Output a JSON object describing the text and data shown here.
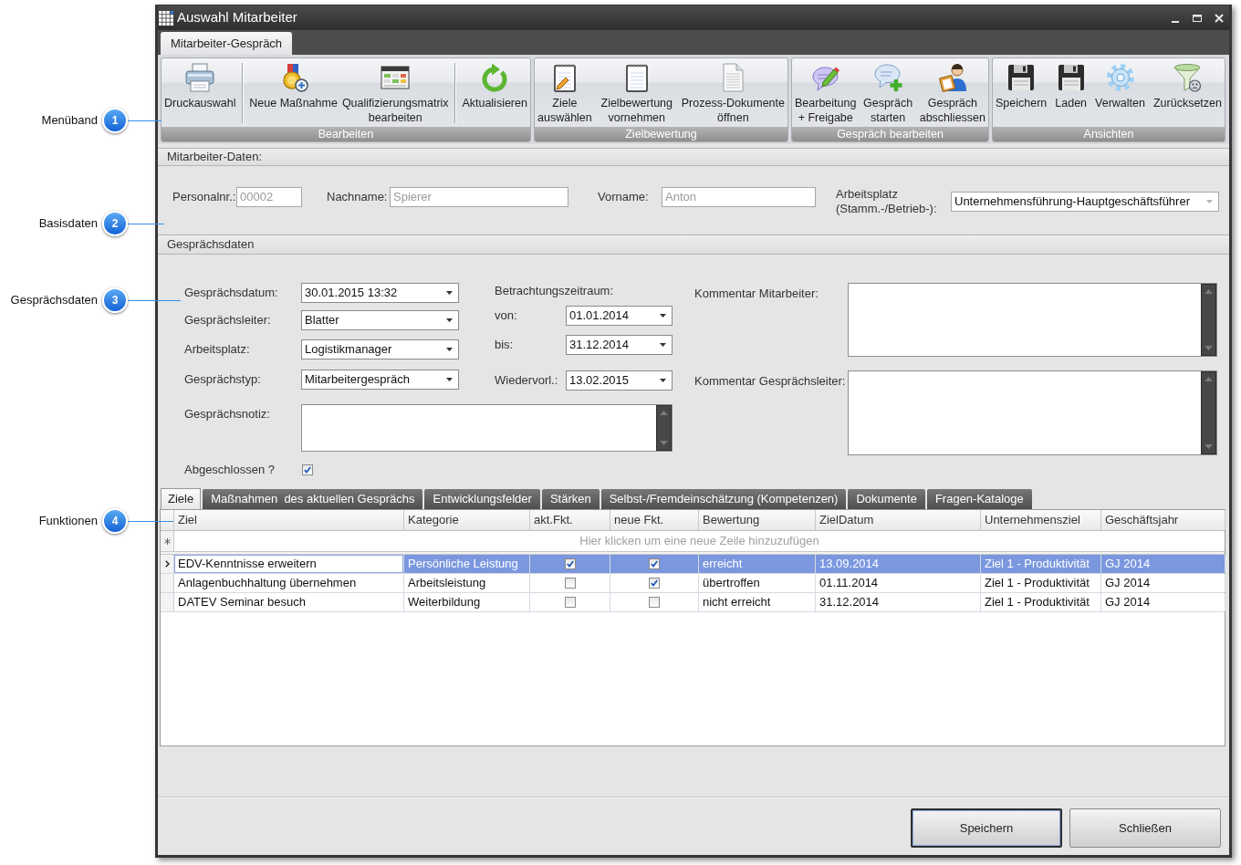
{
  "callouts": [
    {
      "number": "1",
      "label": "Menüband"
    },
    {
      "number": "2",
      "label": "Basisdaten"
    },
    {
      "number": "3",
      "label": "Gesprächsdaten"
    },
    {
      "number": "4",
      "label": "Funktionen"
    }
  ],
  "window": {
    "title": "Auswahl Mitarbeiter"
  },
  "ribbon": {
    "tabs": [
      {
        "label": "Mitarbeiter-Gespräch",
        "selected": true
      }
    ],
    "groups": [
      {
        "title": "Bearbeiten",
        "sections": [
          {
            "buttons": [
              {
                "label": "Druckauswahl"
              }
            ]
          },
          {
            "buttons": [
              {
                "label": "Neue Maßnahme"
              },
              {
                "label": "Qualifizierungsmatrix\nbearbeiten"
              }
            ]
          },
          {
            "buttons": [
              {
                "label": "Aktualisieren"
              }
            ]
          }
        ]
      },
      {
        "title": "Zielbewertung",
        "sections": [
          {
            "buttons": [
              {
                "label": "Ziele\nauswählen"
              },
              {
                "label": "Zielbewertung\nvornehmen"
              },
              {
                "label": "Prozess-Dokumente\nöffnen"
              }
            ]
          }
        ]
      },
      {
        "title": "Gespräch bearbeiten",
        "sections": [
          {
            "buttons": [
              {
                "label": "Bearbeitung\n+ Freigabe"
              },
              {
                "label": "Gespräch\nstarten"
              },
              {
                "label": "Gespräch\nabschliessen"
              }
            ]
          }
        ]
      },
      {
        "title": "Ansichten",
        "sections": [
          {
            "buttons": [
              {
                "label": "Speichern"
              },
              {
                "label": "Laden"
              },
              {
                "label": "Verwalten"
              },
              {
                "label": "Zurücksetzen"
              }
            ]
          }
        ]
      }
    ]
  },
  "mitarbeiter_daten": {
    "title": "Mitarbeiter-Daten:",
    "fields": [
      {
        "kind": "text",
        "label": "Personalnr.:",
        "value": "00002",
        "disabled": true
      },
      {
        "kind": "text",
        "label": "Nachname:",
        "value": "Spierer",
        "disabled": true
      },
      {
        "kind": "text",
        "label": "Vorname:",
        "value": "Anton",
        "disabled": true
      },
      {
        "kind": "dropdown",
        "label": "Arbeitsplatz\n(Stamm.-/Betrieb-):",
        "value": "Unternehmensführung-Hauptgeschäftsführer",
        "disabled": false
      }
    ]
  },
  "gespraechsdaten": {
    "title": "Gesprächsdaten",
    "left_fields": [
      {
        "label": "Gesprächsdatum:",
        "value": "30.01.2015 13:32"
      },
      {
        "label": "Gesprächsleiter:",
        "value": "Blatter"
      },
      {
        "label": "Arbeitsplatz:",
        "value": "Logistikmanager"
      },
      {
        "label": "Gesprächstyp:",
        "value": "Mitarbeitergespräch"
      }
    ],
    "period": {
      "label": "Betrachtungszeitraum:",
      "fields": [
        {
          "label": "von:",
          "value": "01.01.2014"
        },
        {
          "label": "bis:",
          "value": "31.12.2014"
        },
        {
          "label": "Wiedervorl.:",
          "value": "13.02.2015"
        }
      ]
    },
    "note": {
      "label": "Gesprächsnotiz:"
    },
    "closed": {
      "label": "Abgeschlossen ?",
      "checked": true
    },
    "comments": [
      {
        "label": "Kommentar Mitarbeiter:"
      },
      {
        "label": "Kommentar Gesprächsleiter:"
      }
    ]
  },
  "function_tabs": [
    {
      "label": "Ziele",
      "selected": true
    },
    {
      "label": "Maßnahmen  des aktuellen Gesprächs",
      "selected": false
    },
    {
      "label": "Entwicklungsfelder",
      "selected": false
    },
    {
      "label": "Stärken",
      "selected": false
    },
    {
      "label": "Selbst-/Fremdeinschätzung (Kompetenzen)",
      "selected": false
    },
    {
      "label": "Dokumente",
      "selected": false
    },
    {
      "label": "Fragen-Kataloge",
      "selected": false
    }
  ],
  "table": {
    "columns": [
      "Ziel",
      "Kategorie",
      "akt.Fkt.",
      "neue Fkt.",
      "Bewertung",
      "ZielDatum",
      "Unternehmensziel",
      "Geschäftsjahr"
    ],
    "new_row_hint": "Hier klicken um eine neue Zeile hinzuzufügen",
    "rows": [
      {
        "selected": true,
        "current": true,
        "cells": [
          {
            "kind": "text",
            "text": "EDV-Kenntnisse erweitern",
            "focused": true
          },
          {
            "kind": "text",
            "text": "Persönliche Leistung",
            "focused": false
          },
          {
            "kind": "checkbox",
            "checked": true,
            "focused": false
          },
          {
            "kind": "checkbox",
            "checked": true,
            "focused": false
          },
          {
            "kind": "text",
            "text": "erreicht",
            "focused": false
          },
          {
            "kind": "text",
            "text": "13.09.2014",
            "focused": false
          },
          {
            "kind": "text",
            "text": "Ziel 1 - Produktivität",
            "focused": false
          },
          {
            "kind": "text",
            "text": "GJ 2014",
            "focused": false
          }
        ]
      },
      {
        "selected": false,
        "current": false,
        "cells": [
          {
            "kind": "text",
            "text": "Anlagenbuchhaltung übernehmen",
            "focused": false
          },
          {
            "kind": "text",
            "text": "Arbeitsleistung",
            "focused": false
          },
          {
            "kind": "checkbox",
            "checked": false,
            "focused": false
          },
          {
            "kind": "checkbox",
            "checked": true,
            "focused": false
          },
          {
            "kind": "text",
            "text": "übertroffen",
            "focused": false
          },
          {
            "kind": "text",
            "text": "01.11.2014",
            "focused": false
          },
          {
            "kind": "text",
            "text": "Ziel 1 - Produktivität",
            "focused": false
          },
          {
            "kind": "text",
            "text": "GJ 2014",
            "focused": false
          }
        ]
      },
      {
        "selected": false,
        "current": false,
        "cells": [
          {
            "kind": "text",
            "text": "DATEV Seminar besuch",
            "focused": false
          },
          {
            "kind": "text",
            "text": "Weiterbildung",
            "focused": false
          },
          {
            "kind": "checkbox",
            "checked": false,
            "focused": false
          },
          {
            "kind": "checkbox",
            "checked": false,
            "focused": false
          },
          {
            "kind": "text",
            "text": "nicht erreicht",
            "focused": false
          },
          {
            "kind": "text",
            "text": "31.12.2014",
            "focused": false
          },
          {
            "kind": "text",
            "text": "Ziel 1 - Produktivität",
            "focused": false
          },
          {
            "kind": "text",
            "text": "GJ 2014",
            "focused": false
          }
        ]
      }
    ]
  },
  "footer_buttons": [
    {
      "label": "Speichern",
      "focused": true
    },
    {
      "label": "Schließen",
      "focused": false
    }
  ]
}
